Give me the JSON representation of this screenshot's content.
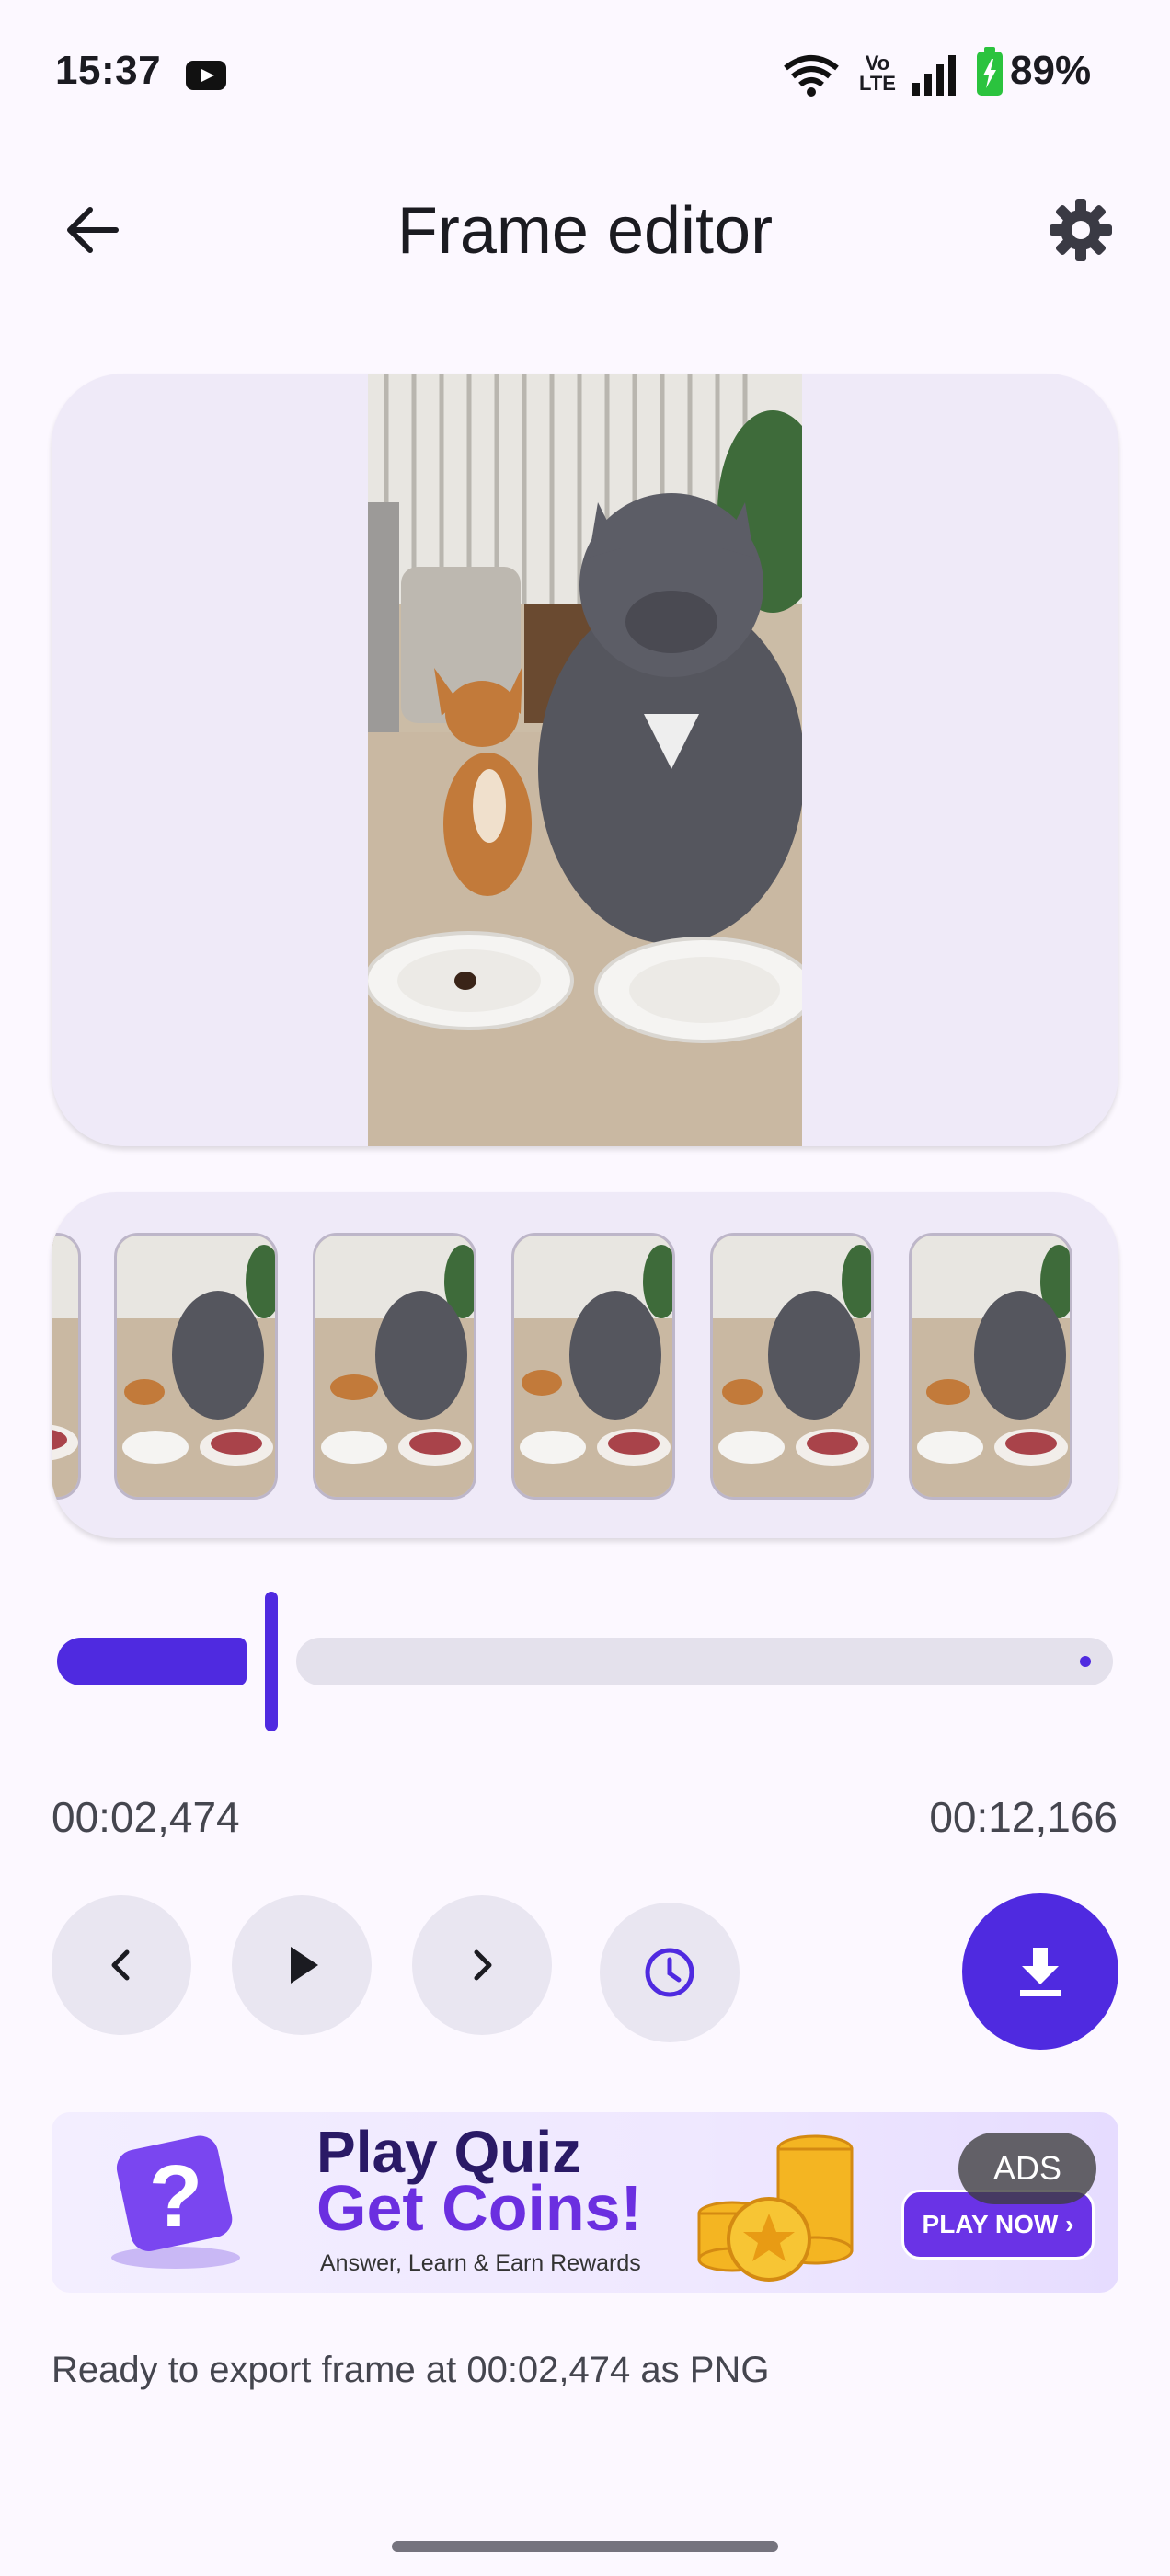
{
  "status_bar": {
    "time": "15:37",
    "notification_icon": "youtube-icon",
    "network_label": "Vo LTE",
    "battery_percent": "89%"
  },
  "app_bar": {
    "title": "Frame editor",
    "back_icon": "arrow-back-icon",
    "settings_icon": "gear-icon"
  },
  "timeline": {
    "current_time": "00:02,474",
    "total_time": "00:12,166",
    "progress": 0.203
  },
  "controls": {
    "prev_icon": "chevron-left-icon",
    "play_icon": "play-icon",
    "next_icon": "chevron-right-icon",
    "time_icon": "clock-icon",
    "download_icon": "download-icon"
  },
  "ad": {
    "line1": "Play Quiz",
    "line2": "Get Coins!",
    "subtitle": "Answer, Learn & Earn Rewards",
    "cta": "PLAY NOW ›",
    "badge": "ADS"
  },
  "export_status": "Ready to export frame at 00:02,474 as PNG",
  "colors": {
    "accent": "#4F2AE0",
    "surface": "#EFEAF8",
    "background": "#FCF8FF"
  }
}
